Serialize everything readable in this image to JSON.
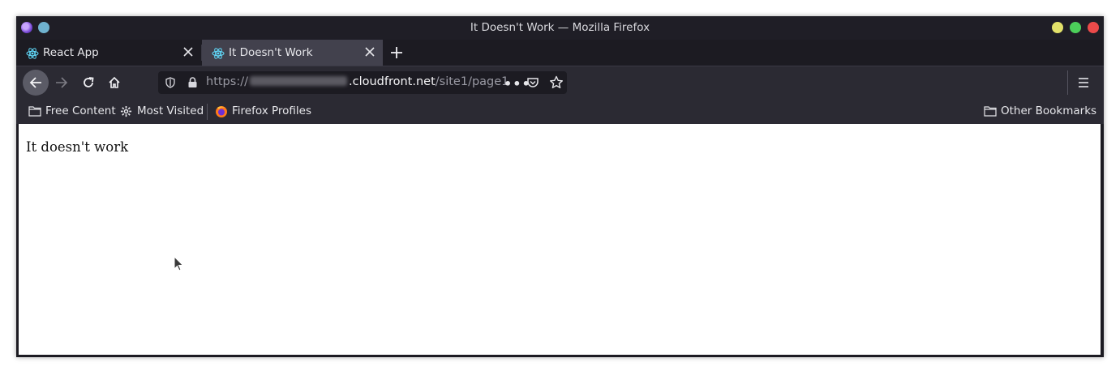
{
  "window": {
    "title": "It Doesn't Work — Mozilla Firefox"
  },
  "tabs": [
    {
      "label": "React App",
      "active": false
    },
    {
      "label": "It Doesn't Work",
      "active": true
    }
  ],
  "navbar": {
    "url_scheme": "https://",
    "url_domain": ".cloudfront.net",
    "url_path": "/site1/page1",
    "more_label": "•••"
  },
  "bookmarks": {
    "items": [
      {
        "label": "Free Content",
        "icon": "folder-icon"
      },
      {
        "label": "Most Visited",
        "icon": "gear-icon"
      },
      {
        "label": "Firefox Profiles",
        "icon": "firefox-icon"
      }
    ],
    "other": {
      "label": "Other Bookmarks",
      "icon": "folder-icon"
    }
  },
  "page": {
    "text": "It doesn't work"
  },
  "colors": {
    "titlebar": "#1f1e26",
    "toolbar": "#2b2a33",
    "active_tab": "#42414d",
    "urlbar": "#1c1b22",
    "minimize": "#e3e26a",
    "maximize": "#4ccf5a",
    "close": "#ec4a4a"
  }
}
